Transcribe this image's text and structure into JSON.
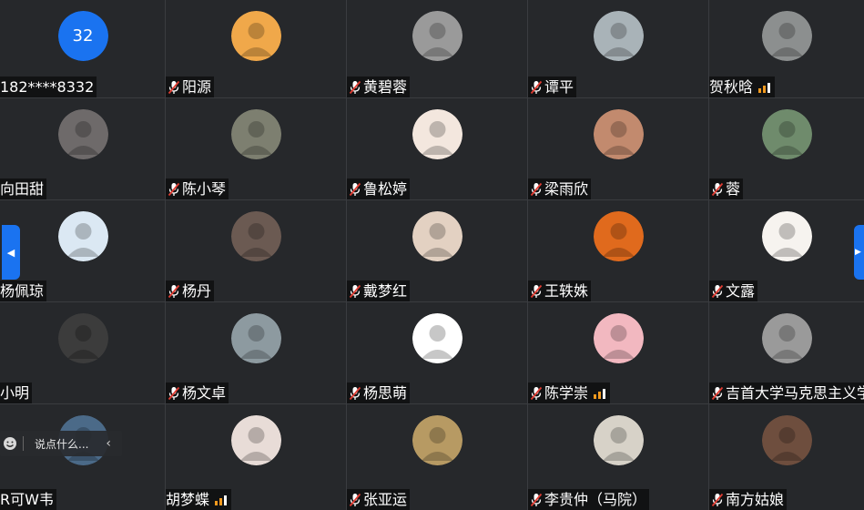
{
  "participants": [
    {
      "name": "182****8332",
      "avatar_text": "32",
      "avatar_color": "#1a73f0",
      "muted": false,
      "signal": false
    },
    {
      "name": "阳源",
      "avatar_color": "#f0a84a",
      "muted": true,
      "signal": false
    },
    {
      "name": "黄碧蓉",
      "avatar_color": "#9a9a9a",
      "muted": true,
      "signal": false
    },
    {
      "name": "谭平",
      "avatar_color": "#a9b3b8",
      "muted": true,
      "signal": false
    },
    {
      "name": "贺秋晗",
      "avatar_color": "#8c8f8f",
      "muted": false,
      "signal": true
    },
    {
      "name": "向田甜",
      "avatar_color": "#6e6a6a",
      "muted": false,
      "signal": false
    },
    {
      "name": "陈小琴",
      "avatar_color": "#7d7f70",
      "muted": true,
      "signal": false
    },
    {
      "name": "鲁松婷",
      "avatar_color": "#f3e7de",
      "muted": true,
      "signal": false
    },
    {
      "name": "梁雨欣",
      "avatar_color": "#c28a6e",
      "muted": true,
      "signal": false
    },
    {
      "name": "蓉",
      "avatar_color": "#6f8b6c",
      "muted": true,
      "signal": false
    },
    {
      "name": "杨佩琼",
      "avatar_color": "#dbe8f3",
      "muted": false,
      "signal": false
    },
    {
      "name": "杨丹",
      "avatar_color": "#6b5a52",
      "muted": true,
      "signal": false
    },
    {
      "name": "戴梦红",
      "avatar_color": "#e3d1c2",
      "muted": true,
      "signal": false
    },
    {
      "name": "王轶姝",
      "avatar_color": "#e06a1d",
      "muted": true,
      "signal": false
    },
    {
      "name": "文露",
      "avatar_color": "#f6f3ef",
      "muted": true,
      "signal": false
    },
    {
      "name": "小明",
      "avatar_color": "#3c3c3c",
      "muted": false,
      "signal": false
    },
    {
      "name": "杨文卓",
      "avatar_color": "#8d9aa0",
      "muted": true,
      "signal": false
    },
    {
      "name": "杨思萌",
      "avatar_color": "#ffffff",
      "muted": true,
      "signal": false
    },
    {
      "name": "陈学崇",
      "avatar_color": "#f2b8c0",
      "muted": true,
      "signal": true
    },
    {
      "name": "吉首大学马克思主义学",
      "avatar_color": "#9a9a9a",
      "muted": true,
      "signal": false
    },
    {
      "name": "R可W韦",
      "avatar_color": "#4b6a88",
      "muted": false,
      "signal": false
    },
    {
      "name": "胡梦蝶",
      "avatar_color": "#e8dcd7",
      "muted": false,
      "signal": true
    },
    {
      "name": "张亚运",
      "avatar_color": "#b79a63",
      "muted": true,
      "signal": false
    },
    {
      "name": "李贵仲（马院）",
      "avatar_color": "#d7d2c8",
      "muted": true,
      "signal": false
    },
    {
      "name": "南方姑娘",
      "avatar_color": "#6e4e3e",
      "muted": true,
      "signal": false
    }
  ],
  "chat": {
    "placeholder": "说点什么..."
  },
  "colors": {
    "accent": "#1a73f0",
    "mic_muted": "#e03c32",
    "signal": "#f29a1e"
  }
}
